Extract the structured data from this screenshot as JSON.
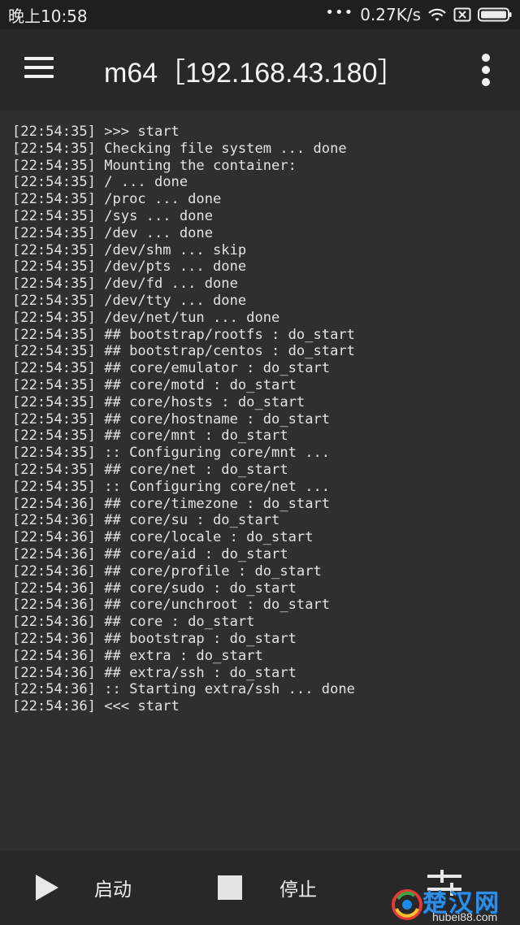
{
  "status_bar": {
    "time": "晚上10:58",
    "dots": "•••",
    "network_speed": "0.27K/s",
    "wifi_icon": "wifi-icon",
    "sim_icon": "no-sim-icon",
    "battery_icon": "battery-icon"
  },
  "app_bar": {
    "menu_icon": "hamburger-menu-icon",
    "title": "m64［192.168.43.180］",
    "overflow_icon": "more-vert-icon"
  },
  "log": {
    "lines": [
      "[22:54:35] >>> start",
      "[22:54:35] Checking file system ... done",
      "[22:54:35] Mounting the container:",
      "[22:54:35] / ... done",
      "[22:54:35] /proc ... done",
      "[22:54:35] /sys ... done",
      "[22:54:35] /dev ... done",
      "[22:54:35] /dev/shm ... skip",
      "[22:54:35] /dev/pts ... done",
      "[22:54:35] /dev/fd ... done",
      "[22:54:35] /dev/tty ... done",
      "[22:54:35] /dev/net/tun ... done",
      "[22:54:35] ## bootstrap/rootfs : do_start",
      "[22:54:35] ## bootstrap/centos : do_start",
      "[22:54:35] ## core/emulator : do_start",
      "[22:54:35] ## core/motd : do_start",
      "[22:54:35] ## core/hosts : do_start",
      "[22:54:35] ## core/hostname : do_start",
      "[22:54:35] ## core/mnt : do_start",
      "[22:54:35] :: Configuring core/mnt ...",
      "[22:54:35] ## core/net : do_start",
      "[22:54:35] :: Configuring core/net ...",
      "[22:54:36] ## core/timezone : do_start",
      "[22:54:36] ## core/su : do_start",
      "[22:54:36] ## core/locale : do_start",
      "[22:54:36] ## core/aid : do_start",
      "[22:54:36] ## core/profile : do_start",
      "[22:54:36] ## core/sudo : do_start",
      "[22:54:36] ## core/unchroot : do_start",
      "[22:54:36] ## core : do_start",
      "[22:54:36] ## bootstrap : do_start",
      "[22:54:36] ## extra : do_start",
      "[22:54:36] ## extra/ssh : do_start",
      "[22:54:36] :: Starting extra/ssh ... done",
      "[22:54:36] <<< start"
    ]
  },
  "toolbar": {
    "start_label": "启动",
    "start_icon": "play-icon",
    "stop_label": "停止",
    "stop_icon": "stop-icon",
    "settings_icon": "settings-sliders-icon"
  },
  "watermark": {
    "text": "楚汉网",
    "url": "hubei88.com"
  },
  "colors": {
    "status_bar_bg": "#1f1f1f",
    "app_bar_bg": "#282828",
    "log_bg": "#2f2f2f",
    "text": "#e2e2e2",
    "watermark_blue": "#2f8fe6"
  }
}
